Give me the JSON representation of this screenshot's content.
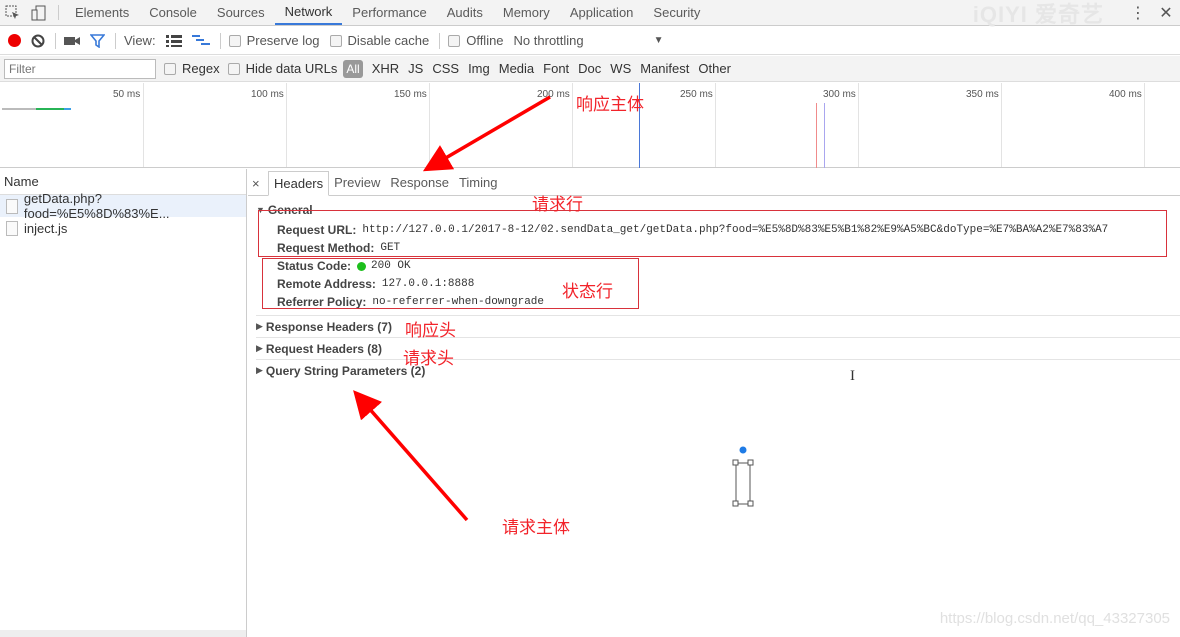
{
  "devtools": {
    "tabs": [
      {
        "label": "Elements"
      },
      {
        "label": "Console"
      },
      {
        "label": "Sources"
      },
      {
        "label": "Network",
        "active": true
      },
      {
        "label": "Performance"
      },
      {
        "label": "Audits"
      },
      {
        "label": "Memory"
      },
      {
        "label": "Application"
      },
      {
        "label": "Security"
      }
    ],
    "watermark_logo": "iQIYI 爱奇艺",
    "icons": {
      "inspect": "inspect-element-icon",
      "device": "device-toolbar-icon",
      "more": "kebab-menu-icon",
      "close": "close-icon"
    }
  },
  "toolbar": {
    "view_label": "View:",
    "preserve_log": "Preserve log",
    "disable_cache": "Disable cache",
    "offline": "Offline",
    "throttling": "No throttling",
    "throttle_arrow": "▼"
  },
  "filterbar": {
    "filter_placeholder": "Filter",
    "regex": "Regex",
    "hide_data_urls": "Hide data URLs",
    "all": "All",
    "types": [
      "XHR",
      "JS",
      "CSS",
      "Img",
      "Media",
      "Font",
      "Doc",
      "WS",
      "Manifest",
      "Other"
    ]
  },
  "overview": {
    "ticks": [
      "50 ms",
      "100 ms",
      "150 ms",
      "200 ms",
      "250 ms",
      "300 ms",
      "350 ms",
      "400 ms"
    ],
    "dom_content_loaded_ms": 222,
    "load_ms": 297
  },
  "requests": {
    "header": "Name",
    "items": [
      {
        "name": "getData.php?food=%E5%8D%83%E...",
        "selected": true
      },
      {
        "name": "inject.js",
        "selected": false
      }
    ]
  },
  "detail": {
    "close": "×",
    "tabs": [
      {
        "label": "Headers",
        "active": true
      },
      {
        "label": "Preview"
      },
      {
        "label": "Response"
      },
      {
        "label": "Timing"
      }
    ],
    "general": {
      "title": "General",
      "request_url_label": "Request URL:",
      "request_url": "http://127.0.0.1/2017-8-12/02.sendData_get/getData.php?food=%E5%8D%83%E5%B1%82%E9%A5%BC&doType=%E7%BA%A2%E7%83%A7",
      "request_method_label": "Request Method:",
      "request_method": "GET",
      "status_code_label": "Status Code:",
      "status_code": "200 OK",
      "remote_address_label": "Remote Address:",
      "remote_address": "127.0.0.1:8888",
      "referrer_policy_label": "Referrer Policy:",
      "referrer_policy": "no-referrer-when-downgrade"
    },
    "sections": [
      {
        "label": "Response Headers (7)"
      },
      {
        "label": "Request Headers (8)"
      },
      {
        "label": "Query String Parameters (2)"
      }
    ]
  },
  "annotations": {
    "response_body": "响应主体",
    "request_line": "请求行",
    "status_line": "状态行",
    "response_headers": "响应头",
    "request_headers": "请求头",
    "request_body": "请求主体",
    "color": "#f2232a"
  },
  "watermark": "https://blog.csdn.net/qq_43327305"
}
